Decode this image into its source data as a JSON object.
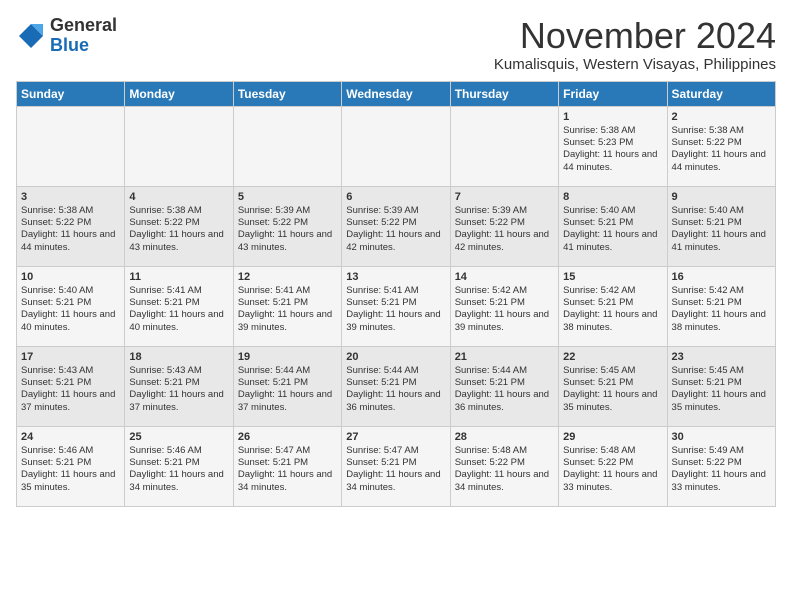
{
  "header": {
    "logo_line1": "General",
    "logo_line2": "Blue",
    "month": "November 2024",
    "location": "Kumalisquis, Western Visayas, Philippines"
  },
  "days_of_week": [
    "Sunday",
    "Monday",
    "Tuesday",
    "Wednesday",
    "Thursday",
    "Friday",
    "Saturday"
  ],
  "weeks": [
    [
      {
        "day": "",
        "info": ""
      },
      {
        "day": "",
        "info": ""
      },
      {
        "day": "",
        "info": ""
      },
      {
        "day": "",
        "info": ""
      },
      {
        "day": "",
        "info": ""
      },
      {
        "day": "1",
        "info": "Sunrise: 5:38 AM\nSunset: 5:23 PM\nDaylight: 11 hours and 44 minutes."
      },
      {
        "day": "2",
        "info": "Sunrise: 5:38 AM\nSunset: 5:22 PM\nDaylight: 11 hours and 44 minutes."
      }
    ],
    [
      {
        "day": "3",
        "info": "Sunrise: 5:38 AM\nSunset: 5:22 PM\nDaylight: 11 hours and 44 minutes."
      },
      {
        "day": "4",
        "info": "Sunrise: 5:38 AM\nSunset: 5:22 PM\nDaylight: 11 hours and 43 minutes."
      },
      {
        "day": "5",
        "info": "Sunrise: 5:39 AM\nSunset: 5:22 PM\nDaylight: 11 hours and 43 minutes."
      },
      {
        "day": "6",
        "info": "Sunrise: 5:39 AM\nSunset: 5:22 PM\nDaylight: 11 hours and 42 minutes."
      },
      {
        "day": "7",
        "info": "Sunrise: 5:39 AM\nSunset: 5:22 PM\nDaylight: 11 hours and 42 minutes."
      },
      {
        "day": "8",
        "info": "Sunrise: 5:40 AM\nSunset: 5:21 PM\nDaylight: 11 hours and 41 minutes."
      },
      {
        "day": "9",
        "info": "Sunrise: 5:40 AM\nSunset: 5:21 PM\nDaylight: 11 hours and 41 minutes."
      }
    ],
    [
      {
        "day": "10",
        "info": "Sunrise: 5:40 AM\nSunset: 5:21 PM\nDaylight: 11 hours and 40 minutes."
      },
      {
        "day": "11",
        "info": "Sunrise: 5:41 AM\nSunset: 5:21 PM\nDaylight: 11 hours and 40 minutes."
      },
      {
        "day": "12",
        "info": "Sunrise: 5:41 AM\nSunset: 5:21 PM\nDaylight: 11 hours and 39 minutes."
      },
      {
        "day": "13",
        "info": "Sunrise: 5:41 AM\nSunset: 5:21 PM\nDaylight: 11 hours and 39 minutes."
      },
      {
        "day": "14",
        "info": "Sunrise: 5:42 AM\nSunset: 5:21 PM\nDaylight: 11 hours and 39 minutes."
      },
      {
        "day": "15",
        "info": "Sunrise: 5:42 AM\nSunset: 5:21 PM\nDaylight: 11 hours and 38 minutes."
      },
      {
        "day": "16",
        "info": "Sunrise: 5:42 AM\nSunset: 5:21 PM\nDaylight: 11 hours and 38 minutes."
      }
    ],
    [
      {
        "day": "17",
        "info": "Sunrise: 5:43 AM\nSunset: 5:21 PM\nDaylight: 11 hours and 37 minutes."
      },
      {
        "day": "18",
        "info": "Sunrise: 5:43 AM\nSunset: 5:21 PM\nDaylight: 11 hours and 37 minutes."
      },
      {
        "day": "19",
        "info": "Sunrise: 5:44 AM\nSunset: 5:21 PM\nDaylight: 11 hours and 37 minutes."
      },
      {
        "day": "20",
        "info": "Sunrise: 5:44 AM\nSunset: 5:21 PM\nDaylight: 11 hours and 36 minutes."
      },
      {
        "day": "21",
        "info": "Sunrise: 5:44 AM\nSunset: 5:21 PM\nDaylight: 11 hours and 36 minutes."
      },
      {
        "day": "22",
        "info": "Sunrise: 5:45 AM\nSunset: 5:21 PM\nDaylight: 11 hours and 35 minutes."
      },
      {
        "day": "23",
        "info": "Sunrise: 5:45 AM\nSunset: 5:21 PM\nDaylight: 11 hours and 35 minutes."
      }
    ],
    [
      {
        "day": "24",
        "info": "Sunrise: 5:46 AM\nSunset: 5:21 PM\nDaylight: 11 hours and 35 minutes."
      },
      {
        "day": "25",
        "info": "Sunrise: 5:46 AM\nSunset: 5:21 PM\nDaylight: 11 hours and 34 minutes."
      },
      {
        "day": "26",
        "info": "Sunrise: 5:47 AM\nSunset: 5:21 PM\nDaylight: 11 hours and 34 minutes."
      },
      {
        "day": "27",
        "info": "Sunrise: 5:47 AM\nSunset: 5:21 PM\nDaylight: 11 hours and 34 minutes."
      },
      {
        "day": "28",
        "info": "Sunrise: 5:48 AM\nSunset: 5:22 PM\nDaylight: 11 hours and 34 minutes."
      },
      {
        "day": "29",
        "info": "Sunrise: 5:48 AM\nSunset: 5:22 PM\nDaylight: 11 hours and 33 minutes."
      },
      {
        "day": "30",
        "info": "Sunrise: 5:49 AM\nSunset: 5:22 PM\nDaylight: 11 hours and 33 minutes."
      }
    ]
  ]
}
